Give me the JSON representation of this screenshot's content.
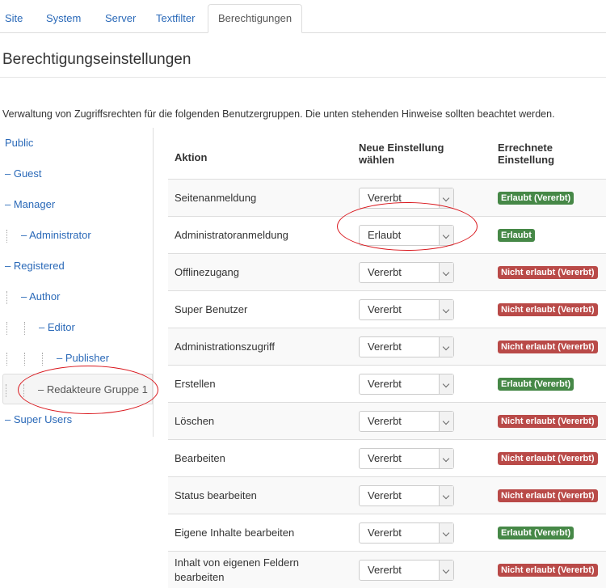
{
  "tabs": [
    {
      "label": "Site"
    },
    {
      "label": "System"
    },
    {
      "label": "Server"
    },
    {
      "label": "Textfilter"
    },
    {
      "label": "Berechtigungen",
      "active": true
    }
  ],
  "page_title": "Berechtigungseinstellungen",
  "description": "Verwaltung von Zugriffsrechten für die folgenden Benutzergruppen. Die unten stehenden Hinweise sollten beachtet werden.",
  "groups": [
    {
      "label": "Public",
      "depth": 0
    },
    {
      "label": "– Guest",
      "depth": 0
    },
    {
      "label": "– Manager",
      "depth": 0
    },
    {
      "label": "– Administrator",
      "depth": 1
    },
    {
      "label": "– Registered",
      "depth": 0
    },
    {
      "label": "– Author",
      "depth": 1
    },
    {
      "label": "– Editor",
      "depth": 2
    },
    {
      "label": "– Publisher",
      "depth": 3
    },
    {
      "label": "– Redakteure Gruppe 1",
      "depth": 2,
      "selected": true
    },
    {
      "label": "– Super Users",
      "depth": 0
    }
  ],
  "table": {
    "headers": {
      "action": "Aktion",
      "new_setting_line1": "Neue Einstellung",
      "new_setting_line2": "wählen",
      "calculated_line1": "Errechnete",
      "calculated_line2": "Einstellung"
    },
    "rows": [
      {
        "action": "Seitenanmeldung",
        "setting": "Vererbt",
        "result": "Erlaubt (Vererbt)",
        "status": "allowed"
      },
      {
        "action": "Administratoranmeldung",
        "setting": "Erlaubt",
        "result": "Erlaubt",
        "status": "allowed"
      },
      {
        "action": "Offlinezugang",
        "setting": "Vererbt",
        "result": "Nicht erlaubt (Vererbt)",
        "status": "denied"
      },
      {
        "action": "Super Benutzer",
        "setting": "Vererbt",
        "result": "Nicht erlaubt (Vererbt)",
        "status": "denied"
      },
      {
        "action": "Administrationszugriff",
        "setting": "Vererbt",
        "result": "Nicht erlaubt (Vererbt)",
        "status": "denied"
      },
      {
        "action": "Erstellen",
        "setting": "Vererbt",
        "result": "Erlaubt (Vererbt)",
        "status": "allowed"
      },
      {
        "action": "Löschen",
        "setting": "Vererbt",
        "result": "Nicht erlaubt (Vererbt)",
        "status": "denied"
      },
      {
        "action": "Bearbeiten",
        "setting": "Vererbt",
        "result": "Nicht erlaubt (Vererbt)",
        "status": "denied"
      },
      {
        "action": "Status bearbeiten",
        "setting": "Vererbt",
        "result": "Nicht erlaubt (Vererbt)",
        "status": "denied"
      },
      {
        "action": "Eigene Inhalte bearbeiten",
        "setting": "Vererbt",
        "result": "Erlaubt (Vererbt)",
        "status": "allowed"
      },
      {
        "action": "Inhalt von eigenen Feldern bearbeiten",
        "setting": "Vererbt",
        "result": "Nicht erlaubt (Vererbt)",
        "status": "denied"
      }
    ]
  },
  "colors": {
    "link": "#2a69b8",
    "allowed_badge": "#468847",
    "denied_badge": "#b94a48",
    "annotation_circle": "#d9161c"
  },
  "icons": {
    "select_arrow": "chevron-down-icon"
  }
}
